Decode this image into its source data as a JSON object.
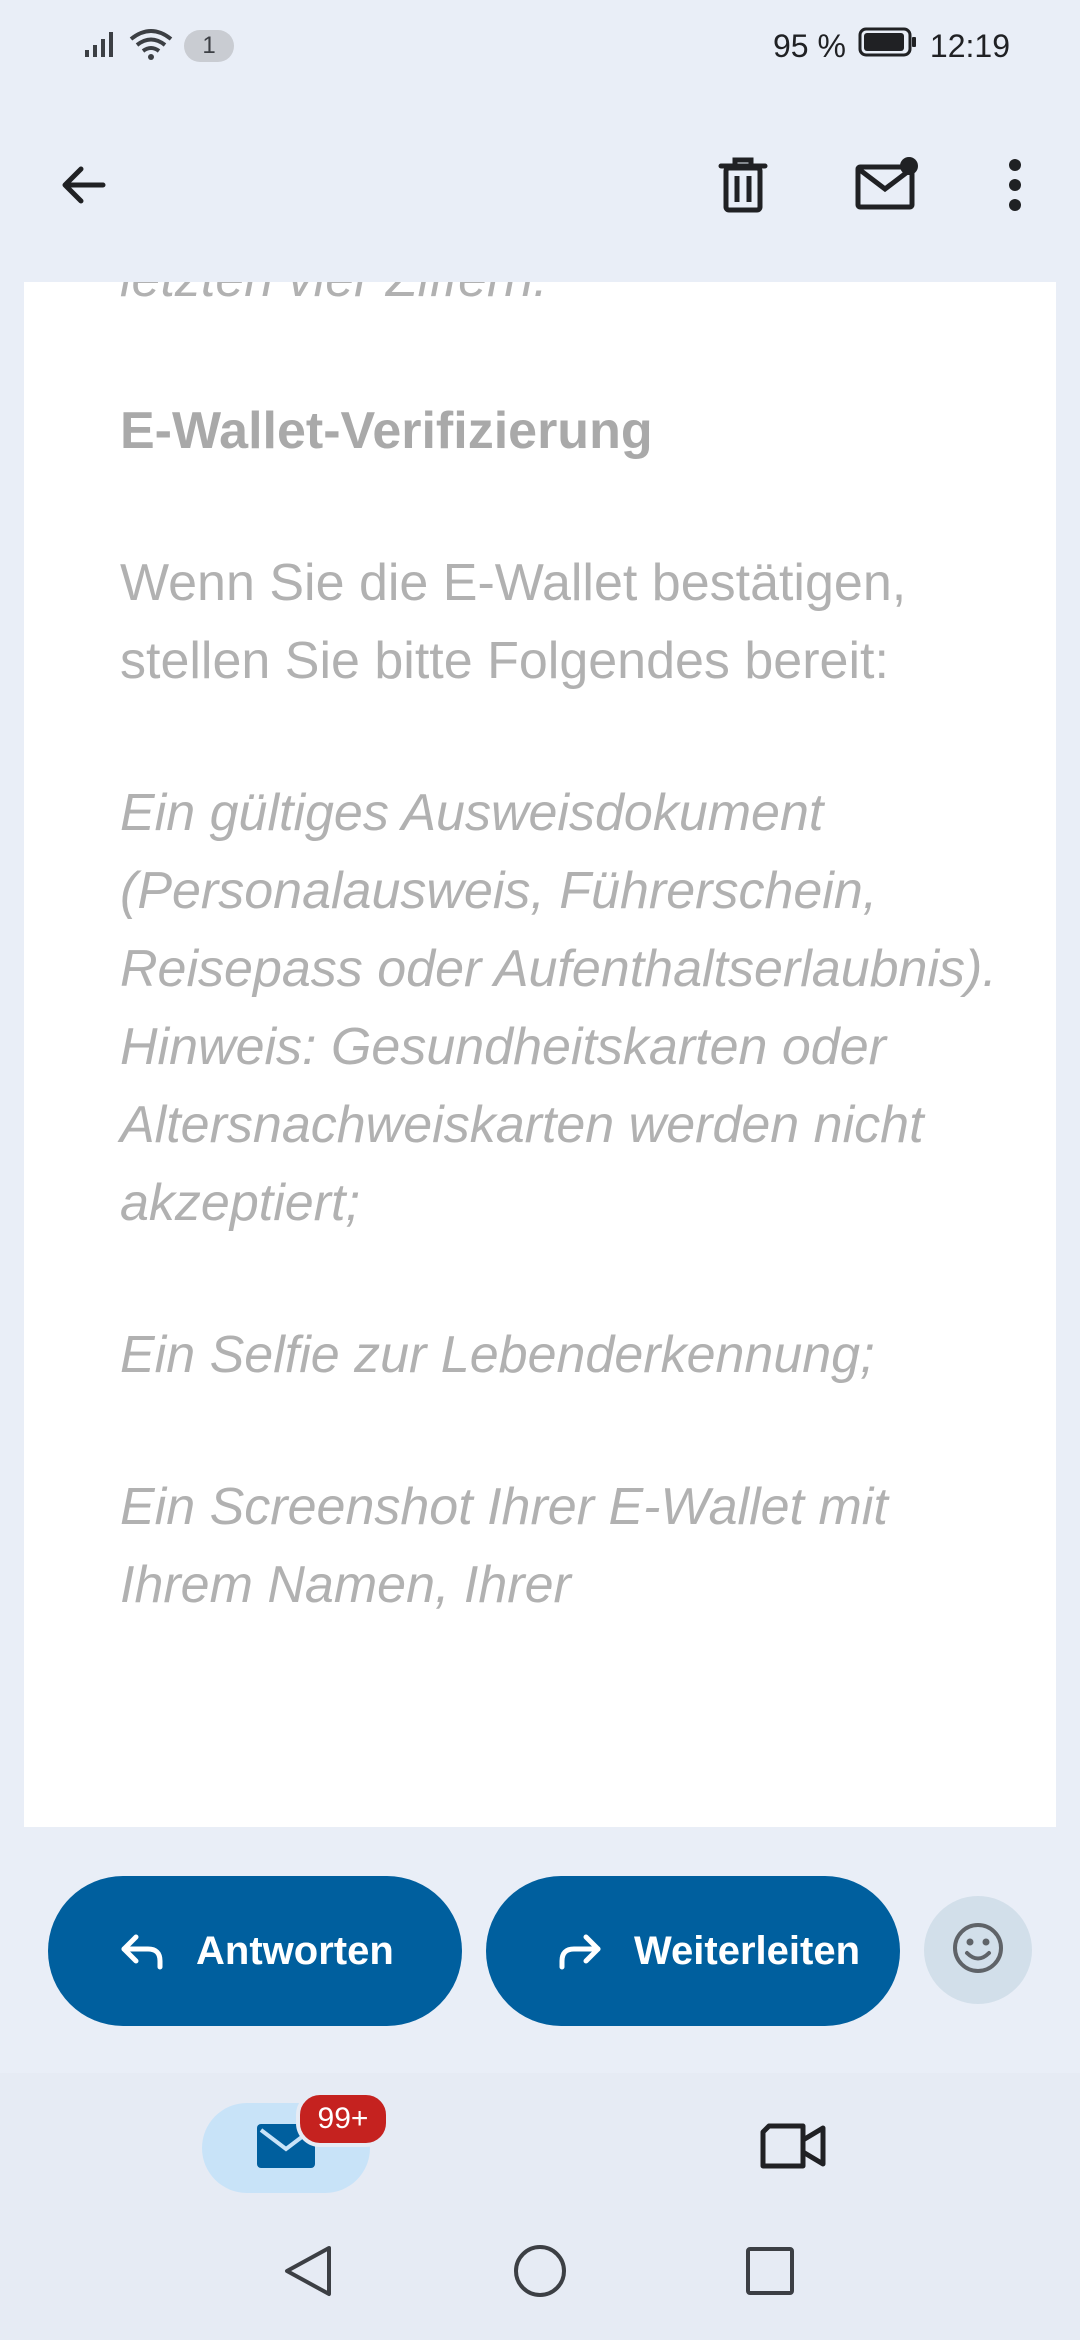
{
  "status_bar": {
    "sim_badge": "1",
    "battery": "95 %",
    "time": "12:19"
  },
  "toolbar": {
    "back_icon": "arrow-left-icon",
    "delete_icon": "trash-icon",
    "unread_icon": "mail-unread-icon",
    "more_icon": "more-vert-icon"
  },
  "email_body": {
    "partial_top": "letzten vier Ziffern.",
    "heading": "E-Wallet-Verifizierung",
    "intro": "Wenn Sie die E-Wallet bestätigen, stellen Sie bitte Folgendes bereit:",
    "item_1": "Ein gültiges Ausweisdokument (Personalausweis, Führerschein, Reisepass oder Aufenthaltserlaubnis). Hinweis: Gesundheitskarten oder Altersnachweiskarten werden nicht akzeptiert;",
    "item_2": "Ein Selfie zur Lebenderkennung;",
    "item_3": "Ein Screenshot Ihrer E-Wallet mit Ihrem Namen, Ihrer"
  },
  "actions": {
    "reply_label": "Antworten",
    "forward_label": "Weiterleiten",
    "emoji_icon": "smiley-icon"
  },
  "bottom_nav": {
    "mail_badge": "99+",
    "mail_icon": "mail-icon",
    "meet_icon": "video-camera-icon"
  },
  "system_nav": {
    "back": "triangle-back-icon",
    "home": "circle-home-icon",
    "recents": "square-recents-icon"
  },
  "colors": {
    "primary": "#005f9e",
    "badge": "#c5221f",
    "background": "#e9eef7"
  }
}
